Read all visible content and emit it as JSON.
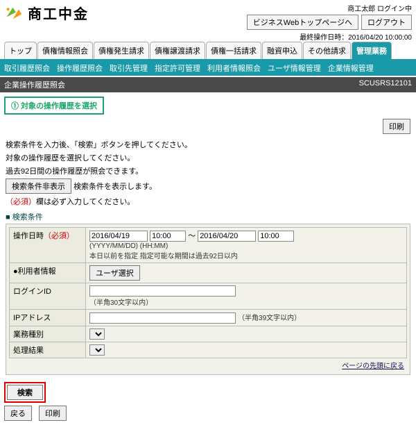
{
  "header": {
    "brand": "商工中金",
    "login_user": "商工太郎 ログイン中",
    "btn_top": "ビジネスWebトップページへ",
    "btn_logout": "ログアウト",
    "last_op": "最終操作日時：2016/04/20 10:00:00"
  },
  "tabs": [
    "トップ",
    "債権情報照会",
    "債権発生請求",
    "債権譲渡請求",
    "債権一括請求",
    "融資申込",
    "その他請求",
    "管理業務"
  ],
  "subnav": [
    "取引履歴照会",
    "操作履歴照会",
    "取引先管理",
    "指定許可管理",
    "利用者情報照会",
    "ユーザ情報管理",
    "企業情報管理"
  ],
  "title": {
    "left": "企業操作履歴照会",
    "right": "SCUSRS12101"
  },
  "step": "① 対象の操作履歴を選択",
  "btn_print": "印刷",
  "instructions": [
    "検索条件を入力後、「検索」ボタンを押してください。",
    "対象の操作履歴を選択してください。",
    "過去92日間の操作履歴が照会できます。"
  ],
  "hide_cond_btn": "検索条件非表示",
  "hide_cond_note": "検索条件を表示します。",
  "required_note_a": "（必須）",
  "required_note_b": "欄は必ず入力してください。",
  "section_search": "検索条件",
  "form": {
    "row_datetime": {
      "label": "操作日時",
      "req": "（必須）",
      "from_d": "2016/04/19",
      "from_t": "10:00",
      "sep": "～",
      "to_d": "2016/04/20",
      "to_t": "10:00",
      "fmt": "(YYYY/MM/DD)  (HH:MM)",
      "note": "本日以前を指定 指定可能な期間は過去92日以内"
    },
    "row_userinfo": {
      "label": "●利用者情報",
      "btn": "ユーザ選択"
    },
    "row_login": {
      "label": "ログインID",
      "hint": "（半角30文字以内）"
    },
    "row_ip": {
      "label": "IPアドレス",
      "hint": "（半角39文字以内）"
    },
    "row_biz": {
      "label": "業務種別"
    },
    "row_result": {
      "label": "処理結果"
    }
  },
  "page_top": "ページの先頭に戻る",
  "btn_search": "検索",
  "btn_back": "戻る",
  "btn_print2": "印刷"
}
